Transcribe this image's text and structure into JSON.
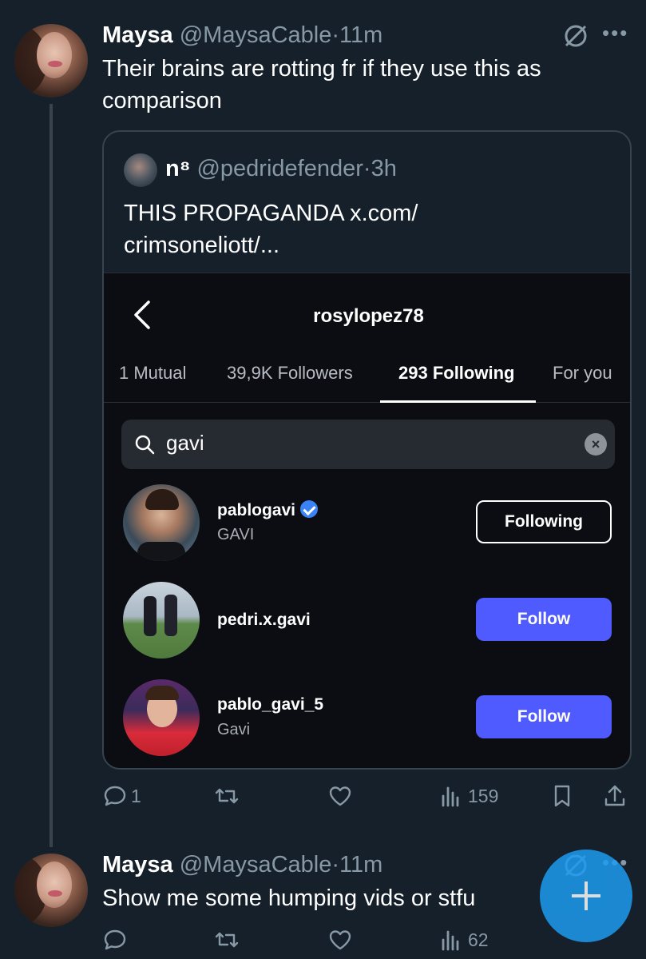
{
  "tweet1": {
    "name": "Maysa",
    "handle": "@MaysaCable",
    "time": "11m",
    "text": "Their brains are rotting fr if they use this as comparison",
    "icons": [
      "grok-icon",
      "more-icon"
    ],
    "quote": {
      "name": "n⁸",
      "handle": "@pedridefender",
      "time": "3h",
      "text": "THIS PROPAGANDA x.com/ crimsoneliott/...",
      "instagram": {
        "title": "rosylopez78",
        "tabs": [
          "1 Mutual",
          "39,9K Followers",
          "293 Following",
          "For you"
        ],
        "active_tab": "293 Following",
        "search_value": "gavi",
        "rows": [
          {
            "username": "pablogavi",
            "verified": true,
            "subtitle": "GAVI",
            "button": "Following"
          },
          {
            "username": "pedri.x.gavi",
            "verified": false,
            "subtitle": "",
            "button": "Follow"
          },
          {
            "username": "pablo_gavi_5",
            "verified": false,
            "subtitle": "Gavi",
            "button": "Follow"
          }
        ]
      }
    },
    "actions": {
      "replies": "1",
      "retweets": "",
      "likes": "",
      "views": "159"
    }
  },
  "tweet2": {
    "name": "Maysa",
    "handle": "@MaysaCable",
    "time": "11m",
    "text": "Show me some humping vids or stfu",
    "actions": {
      "replies": "",
      "retweets": "",
      "likes": "",
      "views": "62"
    }
  },
  "colors": {
    "background": "#15202b",
    "secondary_text": "#8899a6",
    "follow_button": "#4f5bff",
    "fab": "#1d9bf0",
    "verified": "#3b82f6"
  }
}
